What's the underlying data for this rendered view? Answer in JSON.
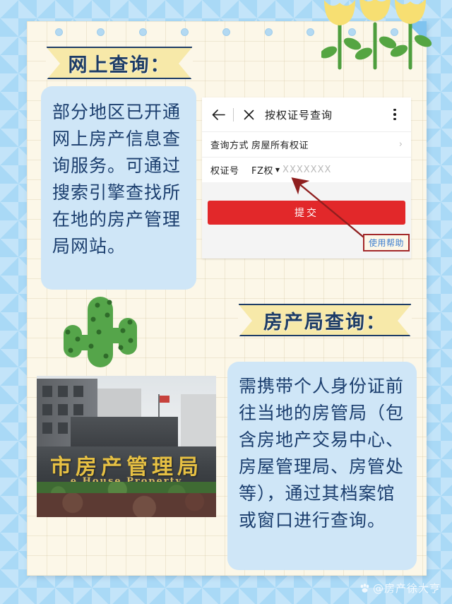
{
  "page": {
    "background_color": "#a9d9f6",
    "paper_color": "#fcf7e8"
  },
  "decorations": {
    "flowers": "yellow-tulips",
    "cactus": "cactus",
    "holes_count": 9
  },
  "sections": [
    {
      "banner_label": "网上查询：",
      "body_text": "部分地区已开通网上房产信息查询服务。可通过搜索引擎查找所在地的房产管理局网站。"
    },
    {
      "banner_label": "房产局查询：",
      "body_text": "需携带个人身份证前往当地的房管局（包含房地产交易中心、房屋管理局、房管处等），通过其档案馆或窗口进行查询。"
    }
  ],
  "app": {
    "title": "按权证号查询",
    "back_icon": "arrow-left-icon",
    "close_icon": "close-icon",
    "menu_icon": "more-vertical-icon",
    "rows": [
      {
        "label": "查询方式",
        "value": "房屋所有权证",
        "chevron": "›"
      },
      {
        "label": "权证号",
        "selector": "FZ权",
        "caret": "▼",
        "placeholder": "XXXXXXX"
      }
    ],
    "submit_label": "提交"
  },
  "annotation": {
    "help_label": "使用帮助",
    "arrow_color": "#8f1f1f",
    "box_border_color": "#a3282a",
    "text_color": "#3d7fd0"
  },
  "photo": {
    "sign_chinese": "市房产管理局",
    "sign_english": "e House Property",
    "alt": "房产管理局 building stone sign"
  },
  "watermark": {
    "icon": "paw-icon",
    "text": "@房产徐大亨"
  },
  "colors": {
    "banner_yellow": "#f7e9a9",
    "banner_navy": "#1d3c66",
    "bluebox": "#cfe6f7",
    "submit_red": "#e2282a"
  }
}
